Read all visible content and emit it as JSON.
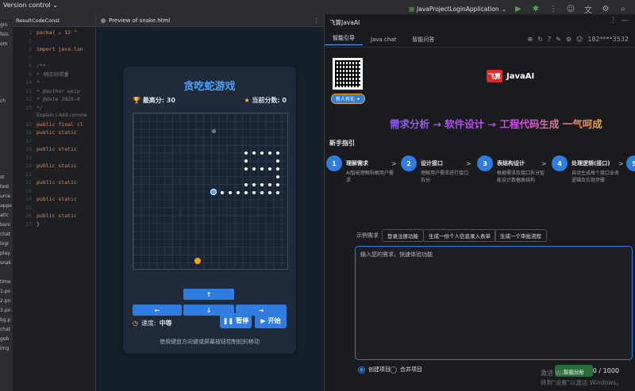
{
  "titlebar": {
    "vcs_label": "Version control",
    "run_config": "JavaProjectLoginApplication",
    "icons": [
      "run-icon",
      "debug-icon",
      "more-icon",
      "user-icon",
      "translate-icon",
      "settings-icon",
      "search-icon"
    ]
  },
  "left_panel": {
    "items": [
      "gin",
      "feis",
      "om",
      "",
      "",
      "",
      "",
      "",
      "ch",
      "",
      "",
      "",
      "",
      "",
      "",
      "",
      "st",
      "test",
      "urce",
      "appe",
      "atic",
      "bani",
      "chat",
      "logi",
      "play",
      "snak",
      "",
      "time",
      "1.pn",
      "2.pn",
      "3.pn",
      "bg.p",
      "chat",
      "gob",
      "img"
    ]
  },
  "editor": {
    "tab_label": "ResultCodeConst",
    "lines": [
      {
        "n": "1",
        "text": "packa( ⚠ 12 ^"
      },
      {
        "n": "2",
        "text": ""
      },
      {
        "n": "3",
        "text": "import java.lan"
      },
      {
        "n": "7",
        "text": ""
      },
      {
        "n": "8",
        "text": "/**"
      },
      {
        "n": "9",
        "text": " * 响应码常量"
      },
      {
        "n": "10",
        "text": " *"
      },
      {
        "n": "11",
        "text": " * @author weip"
      },
      {
        "n": "12",
        "text": " * @date 2025-0"
      },
      {
        "n": "13",
        "text": " */"
      },
      {
        "n": "",
        "text": "Explain | Add comme"
      },
      {
        "n": "15",
        "text": "public final cl"
      },
      {
        "n": "16",
        "text": "public static"
      },
      {
        "n": "17",
        "text": ""
      },
      {
        "n": "18",
        "text": "public static"
      },
      {
        "n": "19",
        "text": ""
      },
      {
        "n": "20",
        "text": "public static"
      },
      {
        "n": "21",
        "text": ""
      },
      {
        "n": "22",
        "text": "public static"
      },
      {
        "n": "23",
        "text": ""
      },
      {
        "n": "24",
        "text": "public static"
      },
      {
        "n": "25",
        "text": ""
      },
      {
        "n": "26",
        "text": "public static"
      },
      {
        "n": "27",
        "text": "}"
      }
    ]
  },
  "preview": {
    "tab_label": "Preview of snake.html",
    "game": {
      "title": "贪吃蛇游戏",
      "high_score_label": "最高分:",
      "high_score": "30",
      "current_score_label": "当前分数:",
      "current_score": "0",
      "speed_label": "速度:",
      "speed_value": "中等",
      "pause_label": "暂停",
      "start_label": "开始",
      "hint": "使用键盘方向键或屏幕按钮控制蛇的移动",
      "up": "↑",
      "left": "←",
      "down": "↓",
      "right": "→"
    }
  },
  "ai": {
    "title": "飞算JavaAI",
    "tabs": [
      "智能引导",
      "Java chat",
      "智能问答"
    ],
    "user": "182****3532",
    "new_user_badge": "新人有礼",
    "logo_mark": "飞算",
    "logo_text": "JavaAI",
    "slogan": "需求分析 → 软件设计 → 工程代码生成 一气呵成",
    "section_title": "新手指引",
    "steps": [
      {
        "num": "1",
        "title": "理解需求",
        "desc": "AI智能理解拆解用户需求"
      },
      {
        "num": "2",
        "title": "设计接口",
        "desc": "理解用户需求进行接口拆分"
      },
      {
        "num": "3",
        "title": "表结构设计",
        "desc": "根据需求及接口拆分智能设计数据表结构"
      },
      {
        "num": "4",
        "title": "处理逻辑(接口)",
        "desc": "自动生成每个接口业务逻辑及实现步骤"
      },
      {
        "num": "5",
        "title": "",
        "desc": ""
      }
    ],
    "examples_label": "示例需求",
    "examples": [
      "登录注册功能",
      "生成一份个人信息录入表单",
      "生成一个审批流程"
    ],
    "input_placeholder": "输入您的需求，快速体验功能",
    "radio_create": "创建项目",
    "radio_merge": "合并项目",
    "send_label": "智能分析",
    "counter": "0 / 1000",
    "watermark_line1": "激活 Windows",
    "watermark_line2": "转到\"设置\"以激活 Windows。"
  },
  "colors": {
    "accent": "#2f7de1",
    "game_title": "#4fa3f7",
    "slogan": "#8a5cf6"
  }
}
